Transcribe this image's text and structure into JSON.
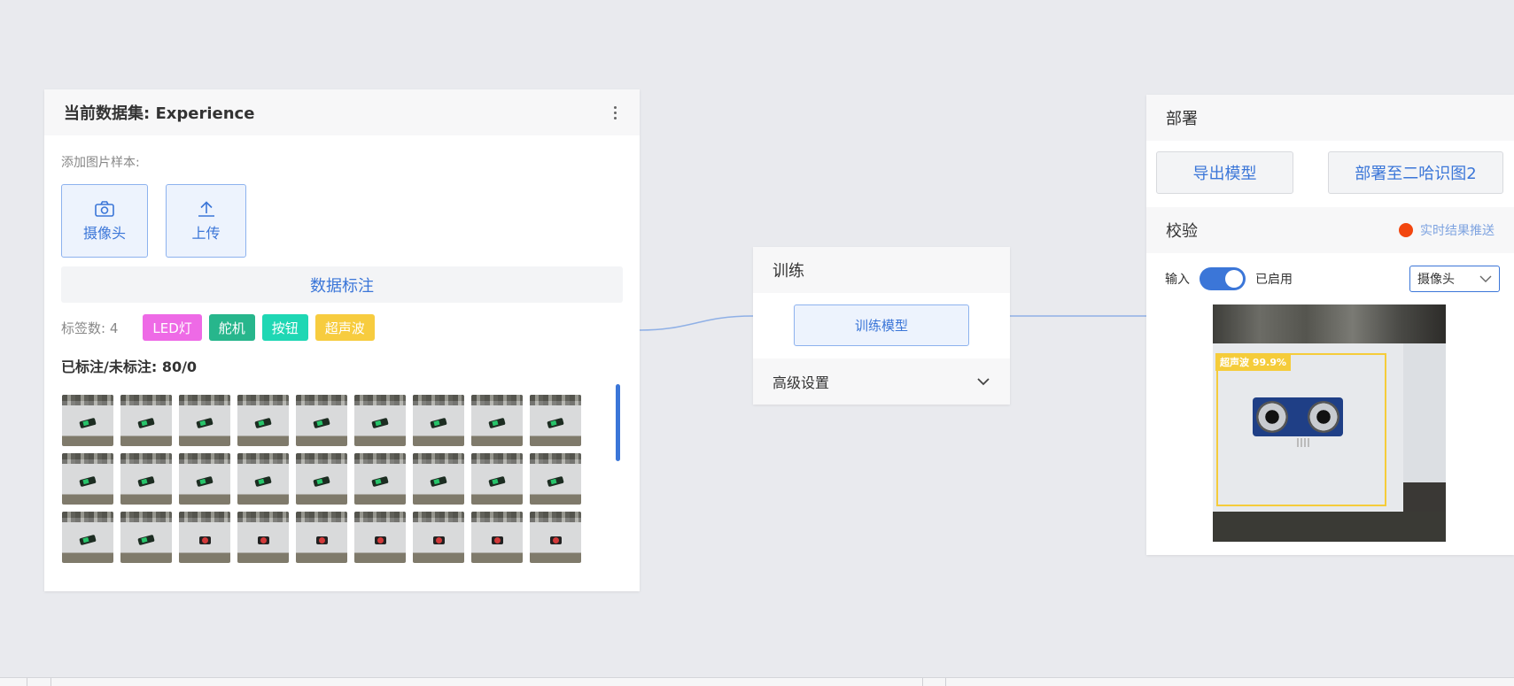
{
  "dataset": {
    "title": "当前数据集: Experience",
    "add_label": "添加图片样本:",
    "camera_label": "摄像头",
    "upload_label": "上传",
    "annotate_label": "数据标注",
    "tag_count": "标签数: 4",
    "tags": [
      {
        "label": "LED灯",
        "color": "#ee6ae6"
      },
      {
        "label": "舵机",
        "color": "#27b68c"
      },
      {
        "label": "按钮",
        "color": "#1fd7b4"
      },
      {
        "label": "超声波",
        "color": "#f7cc3f"
      }
    ],
    "labeled_status": "已标注/未标注: 80/0"
  },
  "train": {
    "title": "训练",
    "train_button": "训练模型",
    "advanced_label": "高级设置"
  },
  "deploy": {
    "title": "部署",
    "export_button": "导出模型",
    "deploy_button": "部署至二哈识图2",
    "verify_title": "校验",
    "push_label": "实时结果推送",
    "input_label": "输入",
    "enabled_label": "已启用",
    "source_select": "摄像头",
    "detection_label": "超声波 99.9%"
  }
}
